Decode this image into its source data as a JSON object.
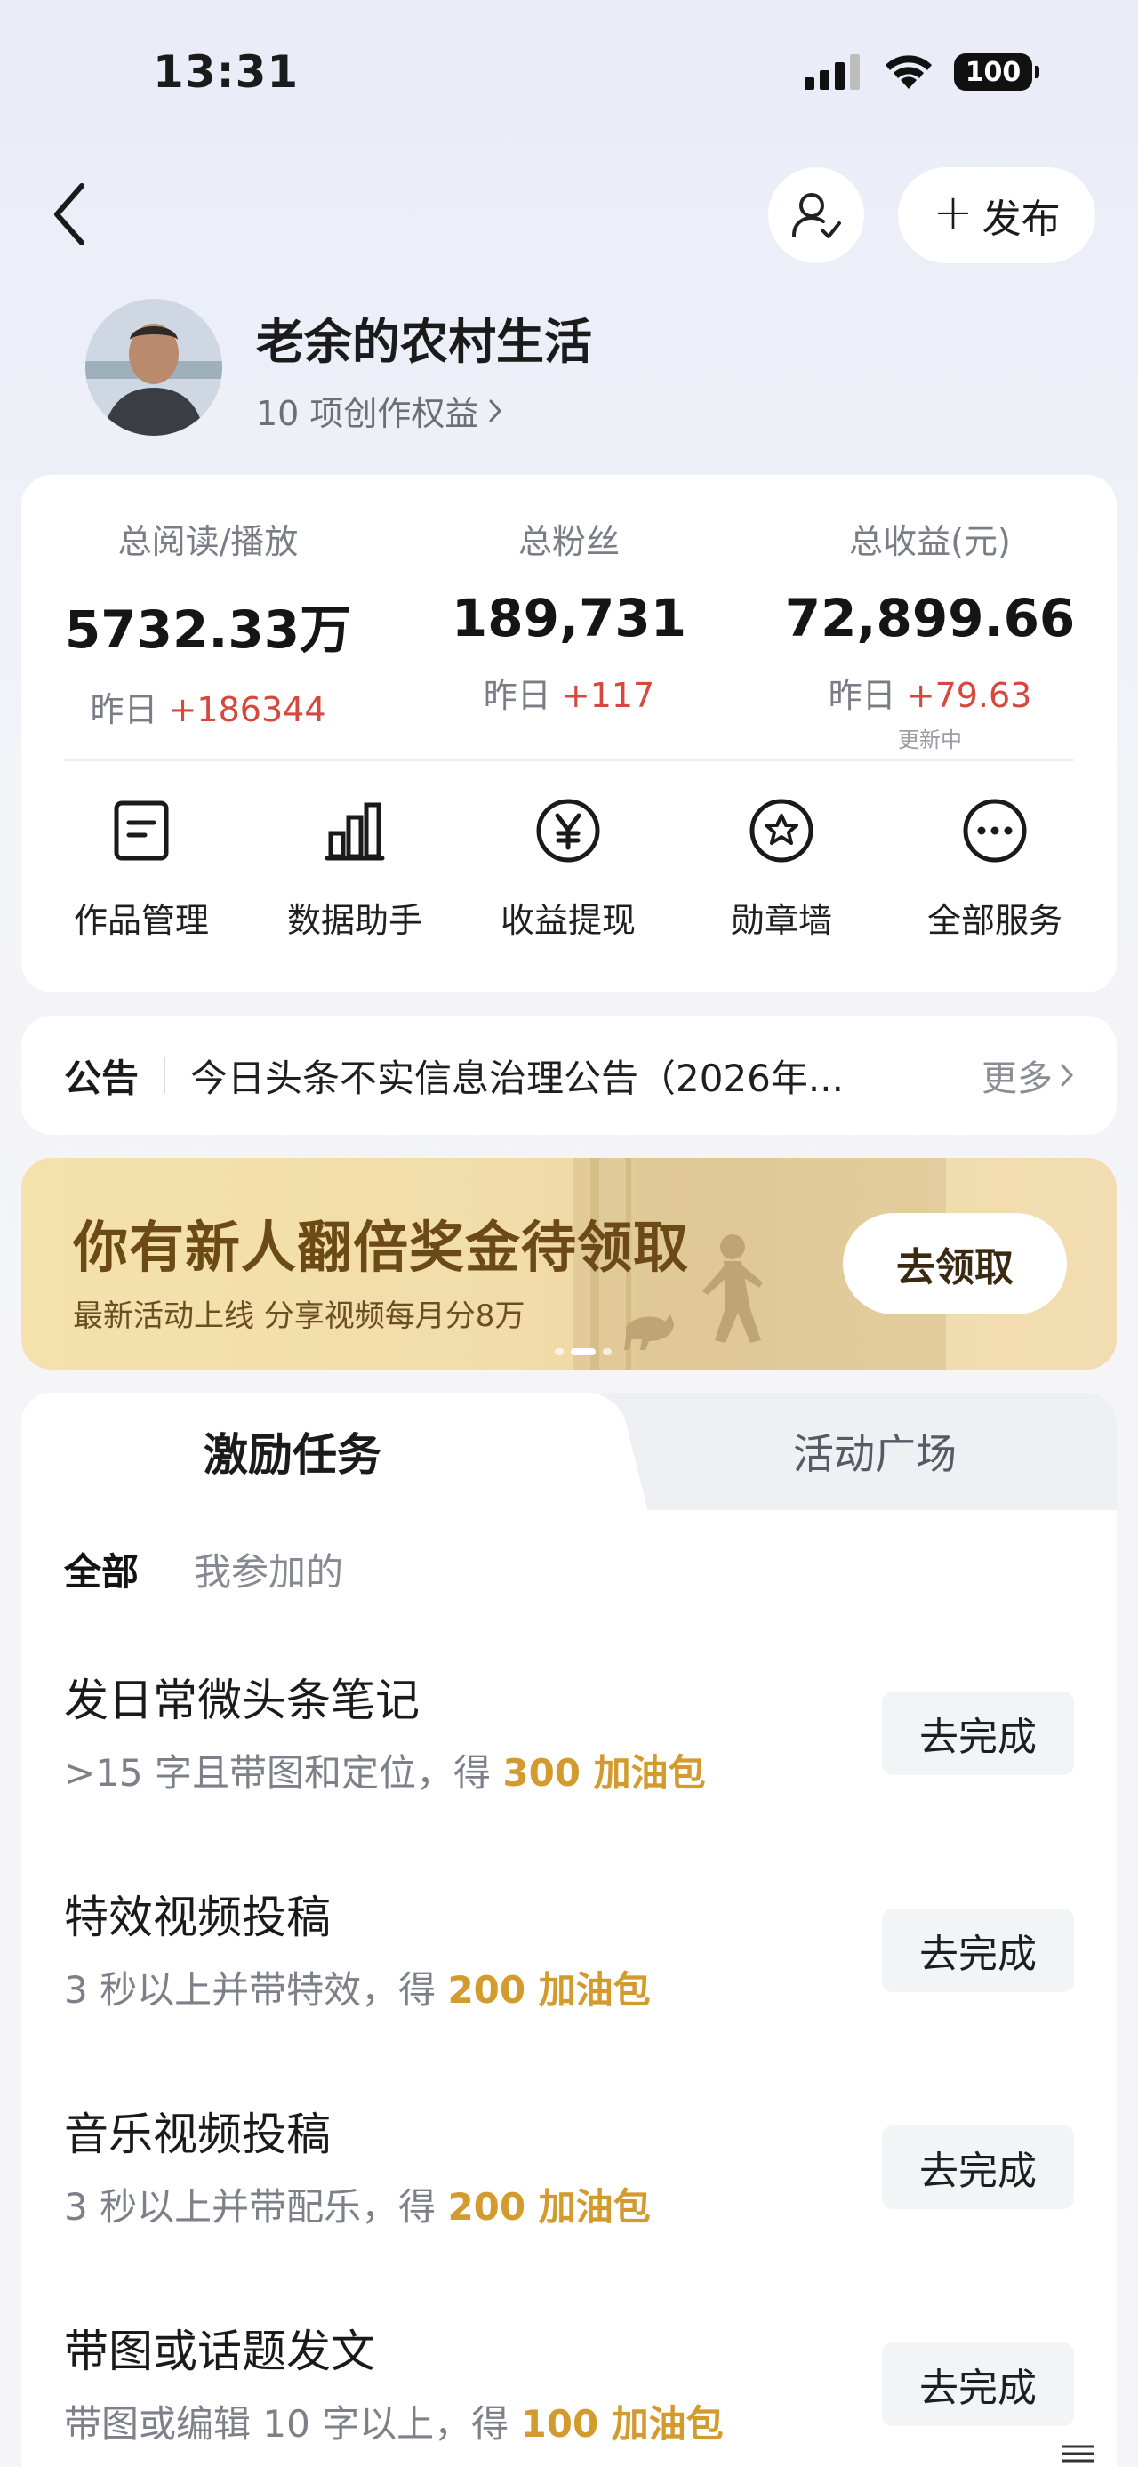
{
  "status_bar": {
    "time": "13:31",
    "battery": "100"
  },
  "header": {
    "publish_label": "发布"
  },
  "profile": {
    "name": "老余的农村生活",
    "rights": "10 项创作权益"
  },
  "stats": [
    {
      "label": "总阅读/播放",
      "value": "5732.33万",
      "change_prefix": "昨日",
      "change": "+186344",
      "note": ""
    },
    {
      "label": "总粉丝",
      "value": "189,731",
      "change_prefix": "昨日",
      "change": "+117",
      "note": ""
    },
    {
      "label": "总收益(元)",
      "value": "72,899.66",
      "change_prefix": "昨日",
      "change": "+79.63",
      "note": "更新中"
    }
  ],
  "services": [
    {
      "label": "作品管理",
      "icon": "document-icon"
    },
    {
      "label": "数据助手",
      "icon": "bar-chart-icon"
    },
    {
      "label": "收益提现",
      "icon": "yen-icon"
    },
    {
      "label": "勋章墙",
      "icon": "medal-icon"
    },
    {
      "label": "全部服务",
      "icon": "more-icon"
    }
  ],
  "notice": {
    "tag": "公告",
    "text": "今日头条不实信息治理公告（2026年...",
    "more": "更多"
  },
  "banner": {
    "title": "你有新人翻倍奖金待领取",
    "subtitle": "最新活动上线 分享视频每月分8万",
    "button": "去领取"
  },
  "tasks_section": {
    "tabs": [
      "激励任务",
      "活动广场"
    ],
    "filters": [
      "全部",
      "我参加的"
    ],
    "items": [
      {
        "title": "发日常微头条笔记",
        "desc": ">15 字且带图和定位，得 ",
        "reward": "300 加油包",
        "button": "去完成"
      },
      {
        "title": "特效视频投稿",
        "desc": "3 秒以上并带特效，得 ",
        "reward": "200 加油包",
        "button": "去完成"
      },
      {
        "title": "音乐视频投稿",
        "desc": "3 秒以上并带配乐，得 ",
        "reward": "200 加油包",
        "button": "去完成"
      },
      {
        "title": "带图或话题发文",
        "desc": "带图或编辑 10 字以上，得 ",
        "reward": "100 加油包",
        "button": "去完成"
      }
    ]
  },
  "colors": {
    "accent_red": "#d6473d",
    "reward_gold": "#d39a2e",
    "banner_title": "#6b4a18"
  }
}
